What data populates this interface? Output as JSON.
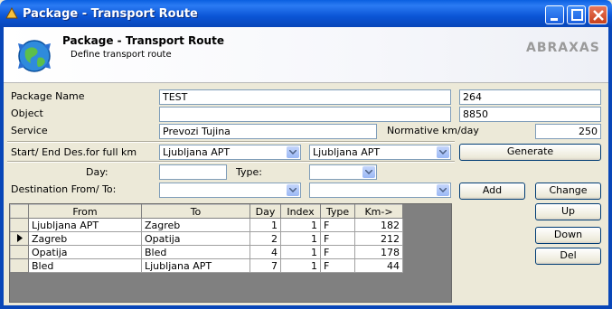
{
  "window": {
    "title": "Package - Transport Route"
  },
  "header": {
    "title": "Package - Transport Route",
    "subtitle": "Define transport route",
    "logo": "ABRAXAS"
  },
  "form": {
    "package_name": {
      "label": "Package Name",
      "value": "TEST",
      "code": "264"
    },
    "object": {
      "label": "Object",
      "value": "",
      "code": "8850"
    },
    "service": {
      "label": "Service",
      "value": "Prevozi Tujina",
      "normative_label": "Normative km/day",
      "normative_value": "250"
    },
    "start_end": {
      "label": "Start/ End Des.for full km",
      "start": "Ljubljana APT",
      "end": "Ljubljana APT"
    },
    "day": {
      "label": "Day:",
      "value": ""
    },
    "type": {
      "label": "Type:",
      "value": ""
    },
    "destination": {
      "label": "Destination From/ To:",
      "from": "",
      "to": ""
    }
  },
  "buttons": {
    "generate": "Generate",
    "add": "Add",
    "change": "Change",
    "up": "Up",
    "down": "Down",
    "del": "Del"
  },
  "grid": {
    "columns": [
      "From",
      "To",
      "Day",
      "Index",
      "Type",
      "Km->"
    ],
    "rows": [
      {
        "from": "Ljubljana APT",
        "to": "Zagreb",
        "day": "1",
        "index": "1",
        "type": "F",
        "km": "182",
        "current": false
      },
      {
        "from": "Zagreb",
        "to": "Opatija",
        "day": "2",
        "index": "1",
        "type": "F",
        "km": "212",
        "current": true
      },
      {
        "from": "Opatija",
        "to": "Bled",
        "day": "4",
        "index": "1",
        "type": "F",
        "km": "178",
        "current": false
      },
      {
        "from": "Bled",
        "to": "Ljubljana APT",
        "day": "7",
        "index": "1",
        "type": "F",
        "km": "44",
        "current": false
      }
    ]
  },
  "colors": {
    "titlebar": "#0b55d6",
    "window_bg": "#ece9d8",
    "grid_bg": "#808080"
  }
}
